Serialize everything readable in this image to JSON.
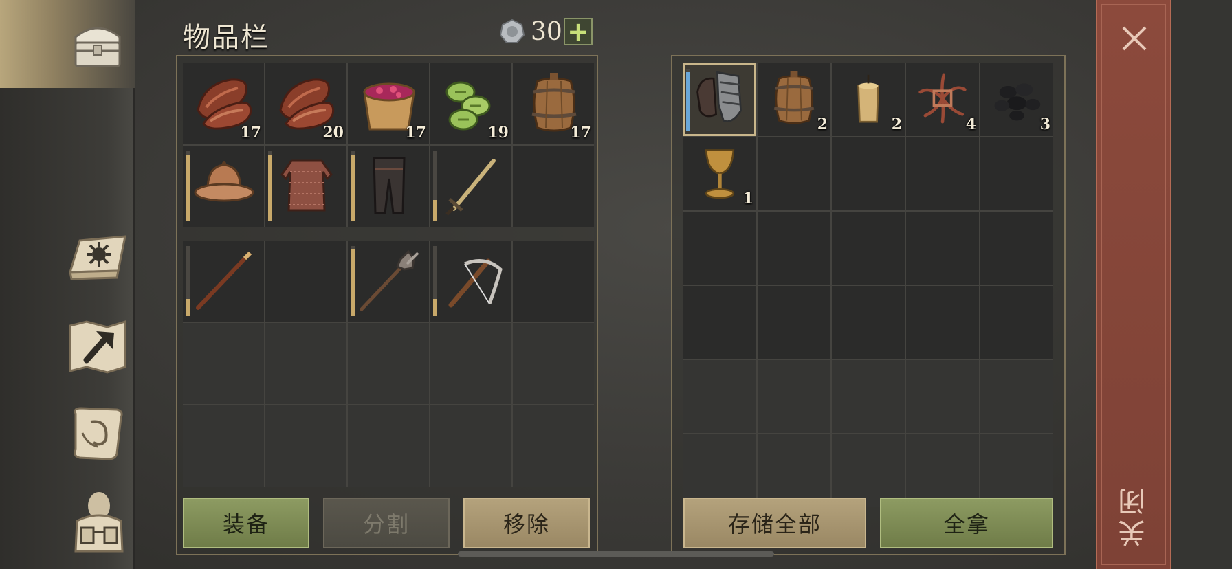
{
  "title": "物品栏",
  "currency": {
    "icon": "silver-coin-icon",
    "count": "30",
    "add_label": "+"
  },
  "sidebar": [
    {
      "name": "chest-icon",
      "active": true
    },
    {
      "name": "sun-book-icon",
      "active": false
    },
    {
      "name": "crafting-map-icon",
      "active": false
    },
    {
      "name": "scroll-quill-icon",
      "active": false
    },
    {
      "name": "character-backpack-icon",
      "active": false
    }
  ],
  "inventory": {
    "rows": [
      [
        {
          "icon": "meat-icon",
          "qty": "17"
        },
        {
          "icon": "meat-icon",
          "qty": "20"
        },
        {
          "icon": "berry-bucket-icon",
          "qty": "17"
        },
        {
          "icon": "green-slices-icon",
          "qty": "19"
        },
        {
          "icon": "barrel-icon",
          "qty": "17"
        }
      ],
      [
        {
          "icon": "helmet-icon",
          "durability": 0.95
        },
        {
          "icon": "chainmail-icon",
          "durability": 0.95
        },
        {
          "icon": "leg-armor-icon",
          "durability": 0.95
        },
        {
          "icon": "sword-icon",
          "durability": 0.3
        },
        {}
      ],
      [
        {
          "icon": "staff-icon",
          "durability": 0.25
        },
        {},
        {
          "icon": "mace-spear-icon",
          "durability": 0.95
        },
        {
          "icon": "crossbow-icon",
          "durability": 0.25
        },
        {}
      ],
      [
        {},
        {},
        {},
        {},
        {}
      ],
      [
        {},
        {},
        {},
        {},
        {}
      ]
    ]
  },
  "storage": {
    "rows": [
      [
        {
          "icon": "gauntlets-icon",
          "selected": true,
          "durability": 0.95
        },
        {
          "icon": "barrel-icon",
          "qty": "2"
        },
        {
          "icon": "candle-icon",
          "qty": "2"
        },
        {
          "icon": "roots-icon",
          "qty": "4"
        },
        {
          "icon": "coal-icon",
          "qty": "3"
        }
      ],
      [
        {
          "icon": "goblet-icon",
          "qty": "1"
        },
        {},
        {},
        {},
        {}
      ],
      [
        {},
        {},
        {},
        {},
        {}
      ],
      [
        {},
        {},
        {},
        {},
        {}
      ],
      [
        {},
        {},
        {},
        {},
        {}
      ],
      [
        {},
        {},
        {},
        {},
        {}
      ]
    ]
  },
  "buttons": {
    "equip": "装备",
    "split": "分割",
    "remove": "移除",
    "store_all": "存储全部",
    "take_all": "全拿"
  },
  "close": {
    "label": "关闭",
    "icon": "close-icon"
  }
}
